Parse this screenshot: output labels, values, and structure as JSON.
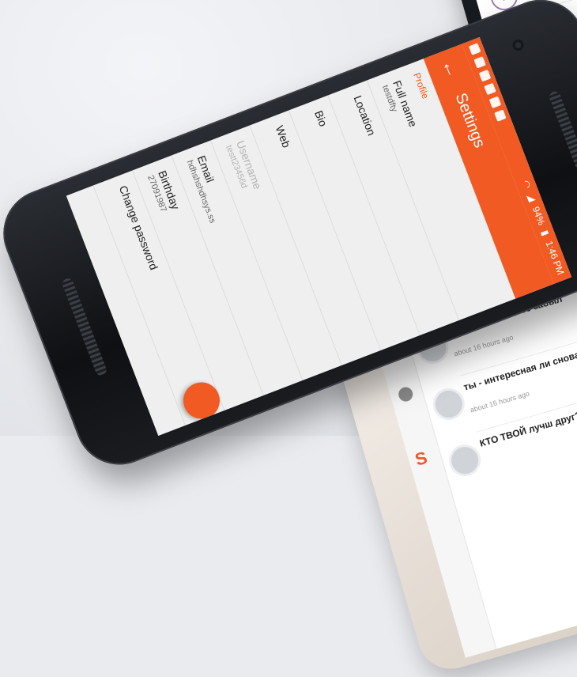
{
  "status_bar": {
    "time": "1:46 PM",
    "battery": "94%"
  },
  "app_bar": {
    "back_icon": "arrow-left-icon",
    "title": "Settings"
  },
  "profile": {
    "section_label": "Profile",
    "rows": [
      {
        "title": "Full name",
        "value": "testdfty"
      },
      {
        "title": "Location",
        "value": ""
      },
      {
        "title": "Bio",
        "value": ""
      },
      {
        "title": "Web",
        "value": ""
      },
      {
        "title": "Username",
        "value": "testt23456d"
      },
      {
        "title": "Email",
        "value": "hdhshshdhsys.ss"
      },
      {
        "title": "Birthday",
        "value": "27091987"
      },
      {
        "title": "Change password",
        "value": ""
      }
    ]
  },
  "feed": {
    "items": [
      {
        "title": "Мы видел уже всё забыл",
        "time": "about 16 hours ago"
      },
      {
        "title": "ты - интересная ли снова общаетс",
        "time": "about 16 hours ago"
      },
      {
        "title": "КТО ТВОЙ лучш друг?",
        "time": ""
      }
    ]
  },
  "colors": {
    "accent": "#f15a22",
    "purple": "#6f3d8c"
  }
}
